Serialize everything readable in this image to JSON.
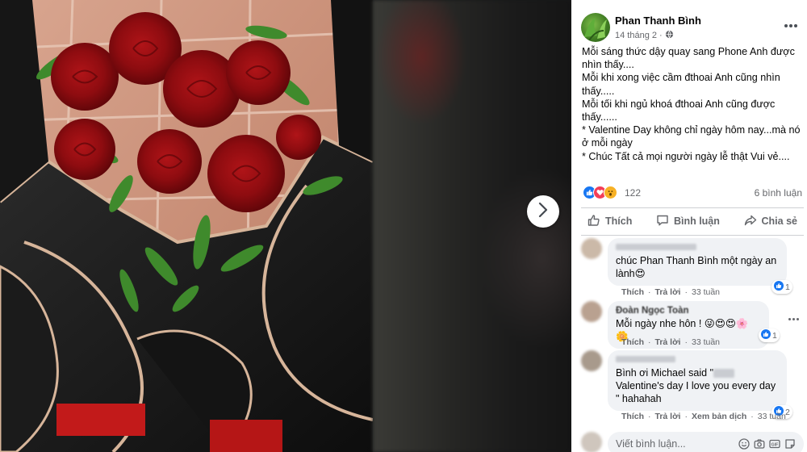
{
  "post": {
    "author": "Phan Thanh Bình",
    "date": "14 tháng 2",
    "privacy_icon": "globe-icon",
    "caption_lines": [
      "Mỗi sáng thức dậy quay sang Phone Anh được nhìn thấy....",
      "Mỗi khi xong việc cầm đthoai Anh cũng nhìn thấy.....",
      "Mỗi tối khi ngủ khoá đthoai Anh cũng được thấy......",
      "* Valentine Day không chỉ ngày hôm nay...mà nó ở mỗi ngày",
      "* Chúc Tất cả mọi người ngày lễ thật Vui vẻ...."
    ],
    "reaction_count": "122",
    "comment_count": "6 bình luận"
  },
  "actions": {
    "like": "Thích",
    "comment": "Bình luận",
    "share": "Chia sẻ"
  },
  "comments": [
    {
      "text": "chúc Phan Thanh Bình một ngày an lành😍",
      "like": "Thích",
      "reply": "Trả lời",
      "time": "33 tuần",
      "reactions": "1"
    },
    {
      "name": "Đoàn Ngọc Toàn",
      "text": "Mỗi ngày nhe hôn ! 😜😍😍🌸🌼",
      "like": "Thích",
      "reply": "Trả lời",
      "time": "33 tuần",
      "reactions": "1"
    },
    {
      "text_a": "Bình ơi Michael said \"",
      "text_b": "Valentine's day I love you every day \" hahahah",
      "like": "Thích",
      "reply": "Trả lời",
      "translate": "Xem bản dịch",
      "time": "33 tuần",
      "reactions": "2"
    }
  ],
  "composer": {
    "placeholder": "Viết bình luận...",
    "icons": [
      "emoji-icon",
      "camera-icon",
      "gif-icon",
      "sticker-icon"
    ]
  },
  "colors": {
    "facebook_blue": "#1877f2",
    "love_red": "#f33e58",
    "wow_yellow": "#f7b125",
    "secondary_text": "#65676b"
  }
}
